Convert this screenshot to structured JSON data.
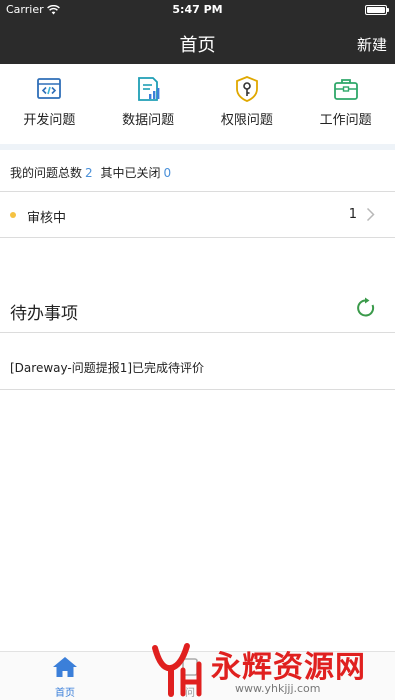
{
  "status_bar": {
    "carrier": "Carrier",
    "time": "5:47 PM"
  },
  "nav": {
    "title": "首页",
    "new_label": "新建"
  },
  "shortcuts": [
    {
      "label": "开发问题",
      "icon": "code-icon"
    },
    {
      "label": "数据问题",
      "icon": "data-chart-icon"
    },
    {
      "label": "权限问题",
      "icon": "key-shield-icon"
    },
    {
      "label": "工作问题",
      "icon": "briefcase-icon"
    }
  ],
  "stats": {
    "total_label": "我的问题总数",
    "total_value": "2",
    "closed_label": "其中已关闭",
    "closed_value": "0"
  },
  "review": {
    "label": "审核中",
    "count": "1"
  },
  "todo": {
    "title": "待办事项",
    "items": [
      {
        "text": "[Dareway-问题提报1]已完成待评价"
      }
    ]
  },
  "tabbar": {
    "home_label": "首页",
    "issues_label": "问"
  },
  "watermark": {
    "brand": "永辉资源网",
    "url": "www.yhkjjj.com"
  },
  "colors": {
    "nav_bg": "#2b2b2b",
    "accent_blue": "#3b7fd9",
    "status_dot": "#f5c242",
    "refresh_green": "#3a9a4a",
    "watermark_red": "#e0201f"
  }
}
